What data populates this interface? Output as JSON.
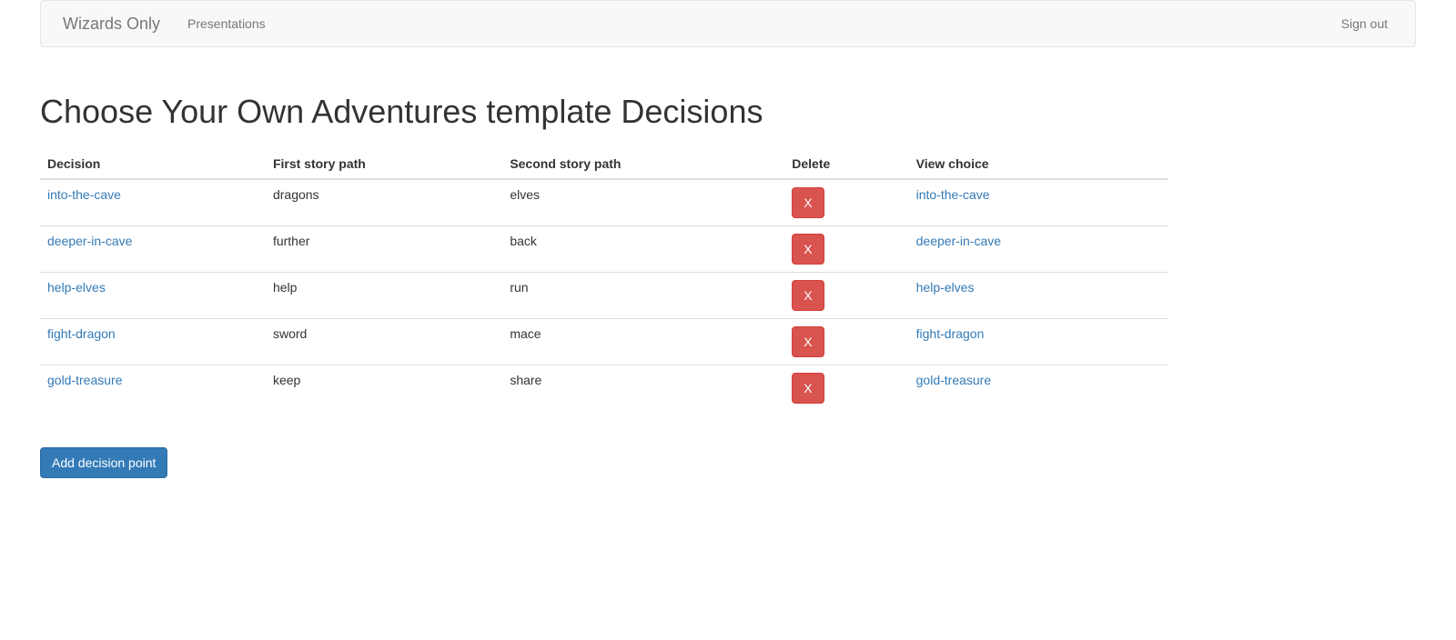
{
  "navbar": {
    "brand": "Wizards Only",
    "links": {
      "presentations": "Presentations",
      "signout": "Sign out"
    }
  },
  "page": {
    "title": "Choose Your Own Adventures template Decisions"
  },
  "table": {
    "headers": {
      "decision": "Decision",
      "first": "First story path",
      "second": "Second story path",
      "delete": "Delete",
      "view": "View choice"
    },
    "deleteLabel": "X",
    "rows": [
      {
        "decision": "into-the-cave",
        "first": "dragons",
        "second": "elves",
        "view": "into-the-cave"
      },
      {
        "decision": "deeper-in-cave",
        "first": "further",
        "second": "back",
        "view": "deeper-in-cave"
      },
      {
        "decision": "help-elves",
        "first": "help",
        "second": "run",
        "view": "help-elves"
      },
      {
        "decision": "fight-dragon",
        "first": "sword",
        "second": "mace",
        "view": "fight-dragon"
      },
      {
        "decision": "gold-treasure",
        "first": "keep",
        "second": "share",
        "view": "gold-treasure"
      }
    ]
  },
  "actions": {
    "addDecision": "Add decision point"
  }
}
